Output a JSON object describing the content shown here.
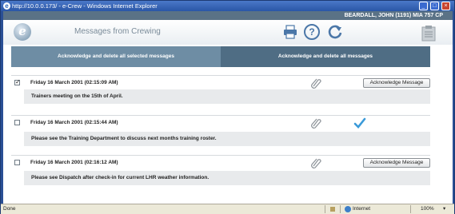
{
  "window": {
    "title": "http://10.0.0.173/ - e-Crew - Windows Internet Explorer"
  },
  "user_info": "BEARDALL, JOHN (1191) MIA 757 CP",
  "header": {
    "logo_text": "e",
    "page_title": "Messages from Crewing",
    "help_glyph": "?"
  },
  "actions": {
    "ack_delete_selected": "Acknowledge and delete all selected messages",
    "ack_delete_all": "Acknowledge and delete all messages"
  },
  "messages": [
    {
      "date": "Friday 16 March 2001 (02:15:09 AM)",
      "text": "Trainers meeting on the 15th of April.",
      "checked": true,
      "acknowledged": false,
      "button_label": "Acknowledge Message"
    },
    {
      "date": "Friday 16 March 2001 (02:15:44 AM)",
      "text": "Please see the Training Department to discuss next months training roster.",
      "checked": false,
      "acknowledged": true
    },
    {
      "date": "Friday 16 March 2001 (02:16:12 AM)",
      "text": "Please see Dispatch after check-in for current LHR weather information.",
      "checked": false,
      "acknowledged": false,
      "button_label": "Acknowledge Message"
    }
  ],
  "status_bar": {
    "status": "Done",
    "zone": "Internet",
    "zoom": "100%"
  },
  "colors": {
    "userbar": "#5a7286",
    "action_left": "#6e8da4",
    "action_right": "#4f6d84",
    "ack_check": "#3a9ad9"
  }
}
